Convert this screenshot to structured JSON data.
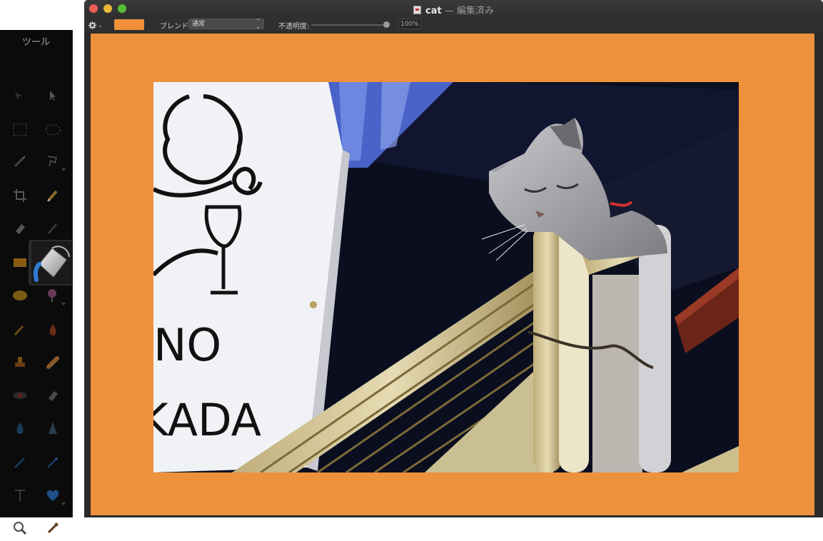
{
  "tools_panel": {
    "title": "ツール",
    "tools": [
      {
        "name": "move-tool-icon"
      },
      {
        "name": "arrow-select-icon"
      },
      {
        "name": "rect-select-icon"
      },
      {
        "name": "ellipse-select-icon"
      },
      {
        "name": "magic-wand-icon"
      },
      {
        "name": "lasso-icon"
      },
      {
        "name": "crop-icon"
      },
      {
        "name": "pencil-icon"
      },
      {
        "name": "eraser-icon"
      },
      {
        "name": "brush-icon"
      },
      {
        "name": "rect-shape-icon"
      },
      {
        "name": "paint-bucket-icon",
        "active": true
      },
      {
        "name": "ellipse-shape-icon"
      },
      {
        "name": "color-picker-icon"
      },
      {
        "name": "smudge-icon"
      },
      {
        "name": "burn-icon"
      },
      {
        "name": "stamp-icon"
      },
      {
        "name": "bandage-icon"
      },
      {
        "name": "red-eye-icon"
      },
      {
        "name": "erase-tool-icon"
      },
      {
        "name": "drop-icon"
      },
      {
        "name": "sharpen-icon"
      },
      {
        "name": "pen-icon"
      },
      {
        "name": "freeform-pen-icon"
      },
      {
        "name": "text-icon"
      },
      {
        "name": "heart-shape-icon"
      },
      {
        "name": "zoom-icon"
      },
      {
        "name": "eyedropper-icon"
      }
    ]
  },
  "window": {
    "title_name": "cat",
    "title_suffix": " — 編集済み"
  },
  "toolbar": {
    "fill_color": "#f0913a",
    "blend_label": "ブレンド:",
    "blend_value": "通常",
    "opacity_label": "不透明度:",
    "opacity_value": "100%",
    "opacity_fraction": 1.0
  },
  "canvas": {
    "background_color": "#ee913c"
  },
  "photo": {
    "sign_text_line1": "NO",
    "sign_text_line2": "KADA"
  }
}
